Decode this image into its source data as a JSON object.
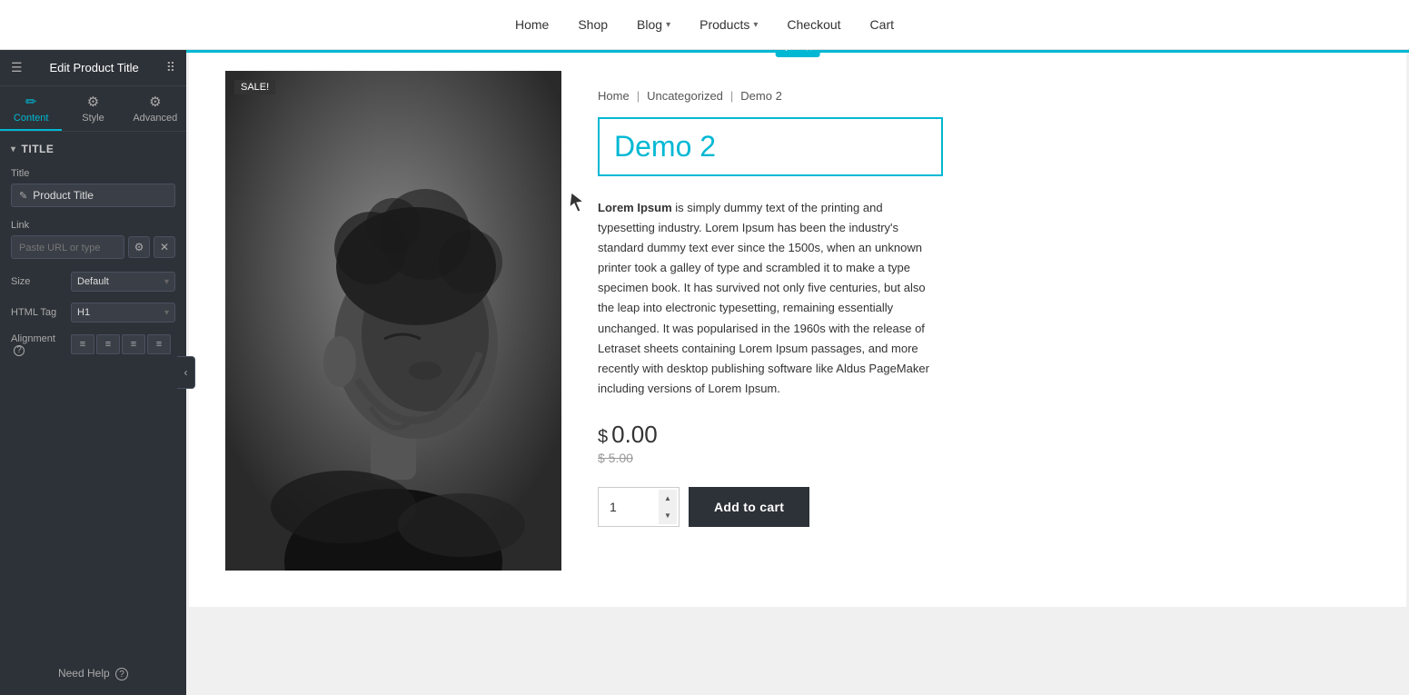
{
  "header": {
    "title": "Edit Product Title",
    "nav": {
      "home": "Home",
      "shop": "Shop",
      "blog": "Blog",
      "products": "Products",
      "checkout": "Checkout",
      "cart": "Cart"
    }
  },
  "sidebar": {
    "title": "Edit Product Title",
    "tabs": [
      {
        "id": "content",
        "label": "Content",
        "icon": "✏️",
        "active": true
      },
      {
        "id": "style",
        "label": "Style",
        "icon": "⚙️",
        "active": false
      },
      {
        "id": "advanced",
        "label": "Advanced",
        "icon": "⚙️",
        "active": false
      }
    ],
    "section_title": "Title",
    "fields": {
      "title_label": "Title",
      "title_value": "Product Title",
      "link_label": "Link",
      "link_placeholder": "Paste URL or type",
      "size_label": "Size",
      "size_value": "Default",
      "html_tag_label": "HTML Tag",
      "html_tag_value": "H1",
      "alignment_label": "Alignment"
    },
    "need_help": "Need Help"
  },
  "product": {
    "breadcrumb": {
      "home": "Home",
      "category": "Uncategorized",
      "current": "Demo 2"
    },
    "title": "Demo 2",
    "sale_badge": "SALE!",
    "description": "Lorem Ipsum is simply dummy text of the printing and typesetting industry. Lorem Ipsum has been the industry's standard dummy text ever since the 1500s, when an unknown printer took a galley of type and scrambled it to make a type specimen book. It has survived not only five centuries, but also the leap into electronic typesetting, remaining essentially unchanged. It was popularised in the 1960s with the release of Letraset sheets containing Lorem Ipsum passages, and more recently with desktop publishing software like Aldus PageMaker including versions of Lorem Ipsum.",
    "current_price": "0.00",
    "currency_symbol": "$",
    "original_price": "$ 5.00",
    "quantity": "1",
    "add_to_cart_label": "Add to cart"
  },
  "canvas_toolbar": {
    "plus": "+",
    "grid": "⠿",
    "close": "×"
  }
}
